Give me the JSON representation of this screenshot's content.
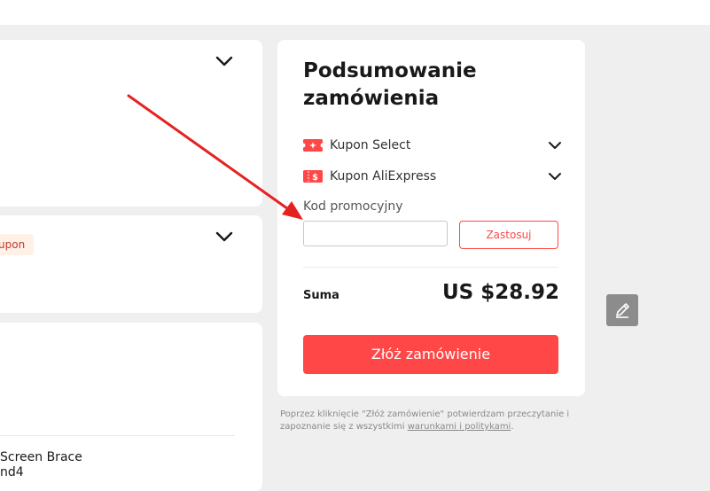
{
  "left": {
    "coupon_tag": "upon",
    "product_name_line1": "Screen Brace",
    "product_name_line2": "nd4"
  },
  "summary": {
    "title_line1": "Podsumowanie",
    "title_line2": "zamówienia",
    "coupons": [
      {
        "label": "Kupon Select",
        "icon": "select-coupon-icon"
      },
      {
        "label": "Kupon AliExpress",
        "icon": "aliexpress-coupon-icon"
      }
    ],
    "promo_label": "Kod promocyjny",
    "promo_value": "",
    "apply_label": "Zastosuj",
    "total_label": "Suma",
    "total_value": "US $28.92",
    "order_button": "Złóż zamówienie"
  },
  "legal": {
    "text_before": "Poprzez kliknięcie \"Złóż zamówienie\" potwierdzam przeczytanie i zapoznanie się z wszystkimi ",
    "link_text": "warunkami i politykami",
    "text_after": "."
  },
  "colors": {
    "accent": "#ff4747",
    "background": "#efefef",
    "annotation_arrow": "#e52222"
  }
}
